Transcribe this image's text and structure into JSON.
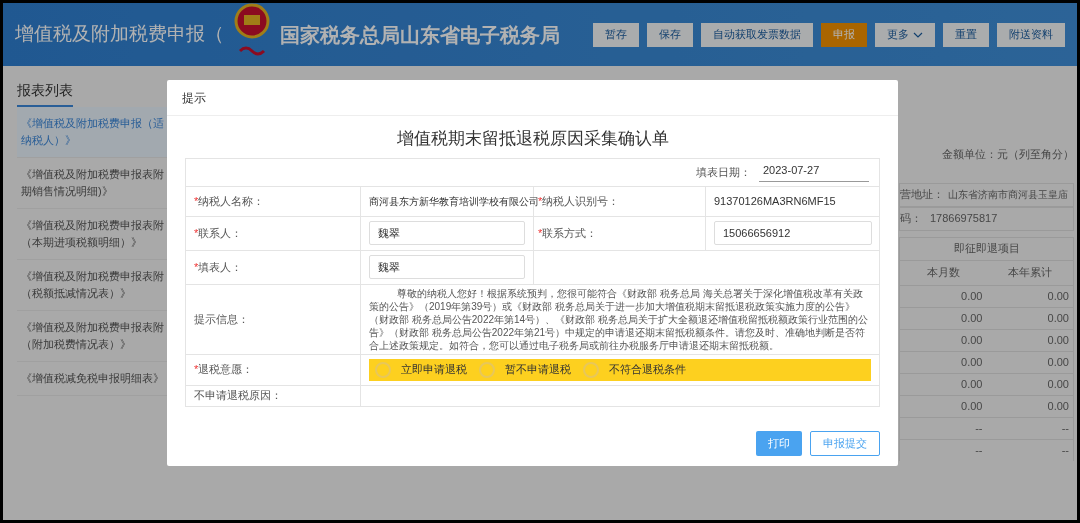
{
  "header": {
    "title": "增值税及附加税费申报（",
    "logo_text": "国家税务总局山东省电子税务局",
    "buttons": [
      {
        "label": "暂存",
        "kind": "plain"
      },
      {
        "label": "保存",
        "kind": "plain"
      },
      {
        "label": "自动获取发票数据",
        "kind": "plain"
      },
      {
        "label": "申报",
        "kind": "primary"
      },
      {
        "label": "更多",
        "kind": "dropdown"
      },
      {
        "label": "重置",
        "kind": "plain"
      },
      {
        "label": "附送资料",
        "kind": "plain"
      }
    ]
  },
  "sidebar": {
    "title": "报表列表",
    "items": [
      {
        "lines": [
          "《增值税及附加税费申报（适",
          "纳税人）》"
        ],
        "selected": true
      },
      {
        "lines": [
          "《增值税及附加税费申报表附",
          "期销售情况明细)》"
        ],
        "selected": false
      },
      {
        "lines": [
          "《增值税及附加税费申报表附",
          "（本期进项税额明细）》"
        ],
        "selected": false
      },
      {
        "lines": [
          "《增值税及附加税费申报表附",
          "（税额抵减情况表）》"
        ],
        "selected": false
      },
      {
        "lines": [
          "《增值税及附加税费申报表附",
          "（附加税费情况表）》"
        ],
        "selected": false
      },
      {
        "lines": [
          "《增值税减免税申报明细表》"
        ],
        "selected": false
      }
    ]
  },
  "background_panel": {
    "unit": "金额单位：元（列至角分）",
    "address_label": "营地址：",
    "address": "山东省济南市商河县玉皇庙",
    "phone_label": "码：",
    "phone": "17866975817",
    "section": "即征即退项目",
    "columns": [
      "本月数",
      "本年累计"
    ],
    "rows": [
      [
        "0.00",
        "0.00"
      ],
      [
        "0.00",
        "0.00"
      ],
      [
        "0.00",
        "0.00"
      ],
      [
        "0.00",
        "0.00"
      ],
      [
        "0.00",
        "0.00"
      ],
      [
        "0.00",
        "0.00"
      ],
      [
        "--",
        "--"
      ],
      [
        "--",
        "--"
      ]
    ]
  },
  "dialog": {
    "title": "提示",
    "form_title": "增值税期末留抵退税原因采集确认单",
    "date": {
      "label": "填表日期：",
      "value": "2023-07-27"
    },
    "taxpayer_name": {
      "label": "纳税人名称：",
      "value": "商河县东方新华教育培训学校有限公司",
      "mark": "*"
    },
    "taxpayer_id": {
      "label": "纳税人识别号：",
      "value": "91370126MA3RN6MF15",
      "mark": "*"
    },
    "contact": {
      "label": "联系人：",
      "value": "魏翠",
      "mark": "*"
    },
    "phone": {
      "label": "联系方式：",
      "value": "15066656912",
      "mark": "*"
    },
    "filler": {
      "label": "填表人：",
      "value": "魏翠",
      "mark": "*"
    },
    "notice": {
      "label": "提示信息：",
      "text": "尊敬的纳税人您好！根据系统预判，您很可能符合《财政部 税务总局 海关总署关于深化增值税改革有关政策的公告》（2019年第39号）或《财政部 税务总局关于进一步加大增值税期末留抵退税政策实施力度的公告》（财政部 税务总局公告2022年第14号）、《财政部 税务总局关于扩大全额退还增值税留抵税额政策行业范围的公告》（财政部 税务总局公告2022年第21号）中规定的申请退还期末留抵税额条件。请您及时、准确地判断是否符合上述政策规定。如符合，您可以通过电子税务局或前往办税服务厅申请退还期末留抵税额。"
    },
    "refund_intent": {
      "label": "退税意愿：",
      "mark": "*",
      "options": [
        {
          "label": "立即申请退税",
          "selected": false
        },
        {
          "label": "暂不申请退税",
          "selected": false
        },
        {
          "label": "不符合退税条件",
          "selected": false
        }
      ]
    },
    "reason": {
      "label": "不申请退税原因："
    },
    "buttons": [
      {
        "label": "打印",
        "kind": "primary"
      },
      {
        "label": "申报提交",
        "kind": "outline"
      }
    ]
  }
}
